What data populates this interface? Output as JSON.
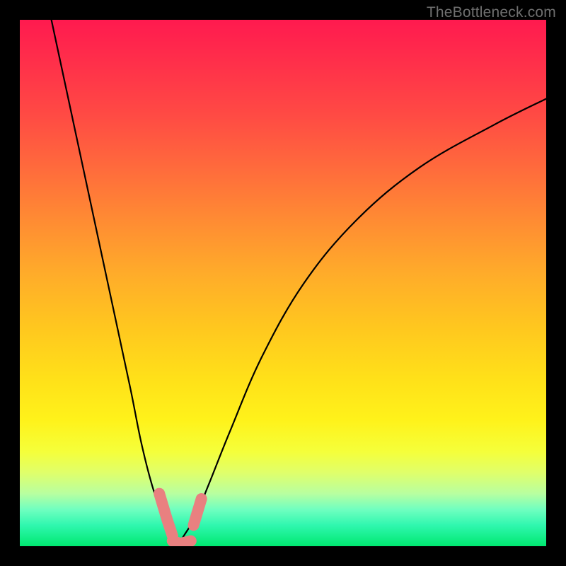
{
  "watermark": "TheBottleneck.com",
  "chart_data": {
    "type": "line",
    "title": "",
    "xlabel": "",
    "ylabel": "",
    "xlim": [
      0,
      100
    ],
    "ylim": [
      0,
      100
    ],
    "grid": false,
    "series": [
      {
        "name": "bottleneck-curve",
        "x": [
          6,
          9,
          12,
          15,
          18,
          21,
          23,
          25,
          27,
          28.5,
          30,
          31.5,
          33.5,
          36,
          40,
          46,
          54,
          64,
          76,
          90,
          100
        ],
        "y": [
          100,
          86,
          72,
          58,
          44,
          30,
          20,
          12,
          6,
          2.5,
          0.8,
          2.5,
          6,
          12,
          22,
          36,
          50,
          62,
          72,
          80,
          85
        ]
      }
    ],
    "markers": [
      {
        "name": "left-red-marker",
        "x": [
          26.5,
          28,
          29
        ],
        "y": [
          10,
          5,
          2
        ]
      },
      {
        "name": "bottom-red-marker",
        "x": [
          29,
          30.5,
          32.5
        ],
        "y": [
          1,
          0.5,
          1
        ]
      },
      {
        "name": "right-red-marker",
        "x": [
          33,
          34.5
        ],
        "y": [
          4,
          9
        ]
      }
    ],
    "gradient_stops": [
      {
        "pos": 0,
        "color": "#ff1a4f"
      },
      {
        "pos": 50,
        "color": "#ffab2a"
      },
      {
        "pos": 80,
        "color": "#fff21a"
      },
      {
        "pos": 100,
        "color": "#00e870"
      }
    ]
  }
}
